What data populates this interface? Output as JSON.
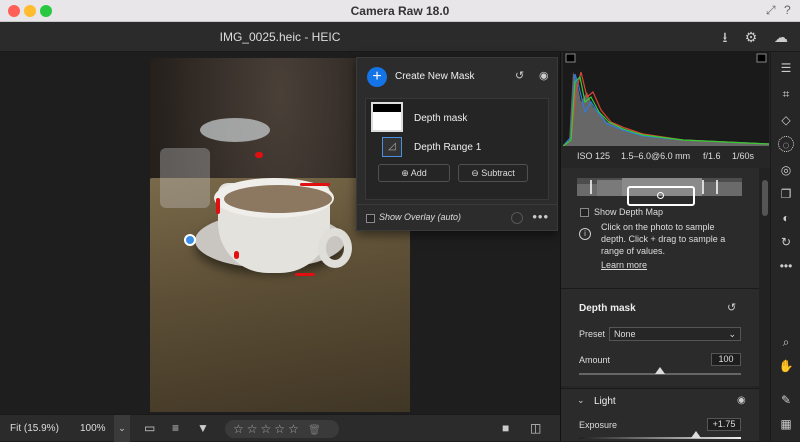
{
  "window": {
    "title": "Camera Raw 18.0"
  },
  "appbar": {
    "filename": "IMG_0025.heic  -  HEIC"
  },
  "mask_panel": {
    "create_label": "Create New Mask",
    "mask_name": "Depth mask",
    "component_name": "Depth Range 1",
    "add_label": "Add",
    "subtract_label": "Subtract",
    "overlay_label": "Show Overlay (auto)",
    "overlay_checked": false
  },
  "camera_info": {
    "iso": "ISO 125",
    "lens": "1.5–6.0@6.0 mm",
    "aperture": "f/1.6",
    "shutter": "1/60s"
  },
  "depth": {
    "show_depth_map_label": "Show Depth Map",
    "info_line1": "Click on the photo to sample",
    "info_line2": "depth. Click + drag to sample a",
    "info_line3": "range of values.",
    "learn_more": "Learn more"
  },
  "mask_settings": {
    "title": "Depth mask",
    "preset_label": "Preset",
    "preset_value": "None",
    "amount_label": "Amount",
    "amount_value": "100",
    "amount_fraction": 1.0
  },
  "light": {
    "title": "Light",
    "exposure_label": "Exposure",
    "exposure_value": "+1.75"
  },
  "bottombar": {
    "fit_label": "Fit (15.9%)",
    "zoom_label": "100%",
    "rating_stars": "☆☆☆☆☆"
  },
  "colors": {
    "accent": "#1473e6",
    "mask_overlay": "#e01010"
  }
}
